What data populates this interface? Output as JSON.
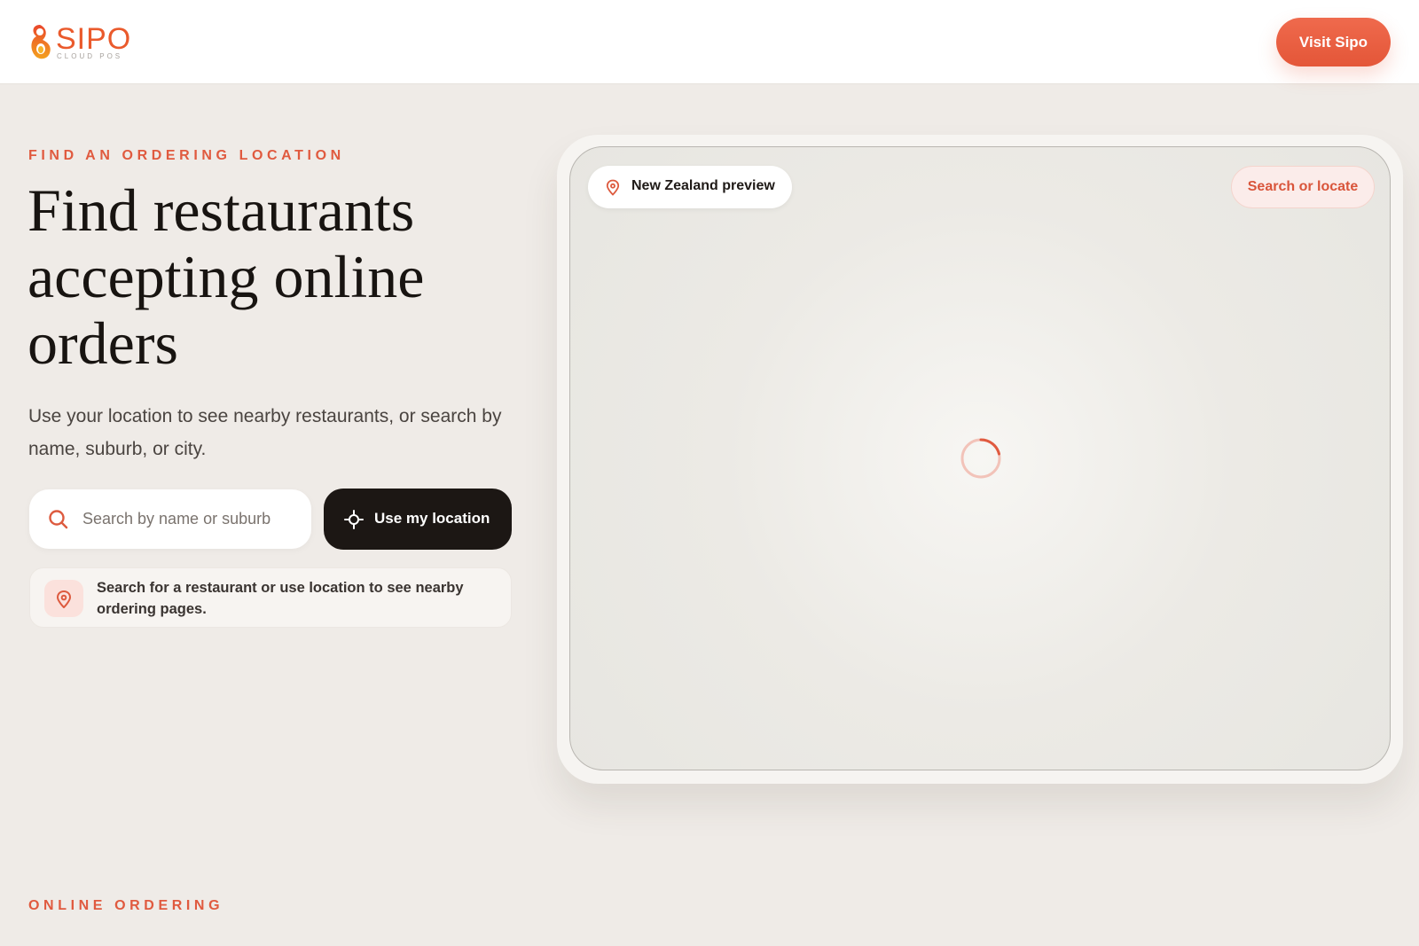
{
  "header": {
    "logo_text": "SIPO",
    "logo_subtitle": "CLOUD POS",
    "visit_button": "Visit Sipo"
  },
  "hero": {
    "eyebrow": "FIND AN ORDERING LOCATION",
    "title": "Find restaurants accepting online orders",
    "description": "Use your location to see nearby restaurants, or search by name, suburb, or city."
  },
  "search": {
    "placeholder": "Search by name or suburb",
    "value": "",
    "location_button": "Use my location",
    "hint": "Search for a restaurant or use location to see nearby ordering pages."
  },
  "map": {
    "region_label": "New Zealand preview",
    "locate_button": "Search or locate",
    "status": "loading"
  },
  "section2": {
    "eyebrow": "ONLINE ORDERING"
  },
  "icons": {
    "search": "search-icon",
    "crosshair": "crosshair-icon",
    "pin": "map-pin-icon",
    "spinner": "loading-spinner-icon"
  },
  "colors": {
    "accent": "#e05a3f",
    "dark_button": "#1c1714",
    "background": "#efebe7"
  }
}
